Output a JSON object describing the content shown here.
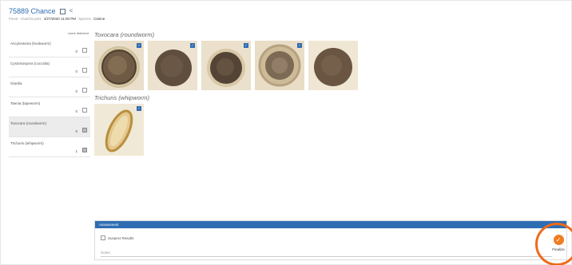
{
  "header": {
    "title": "75889 Chance",
    "sub_type": "Fecal - Ova/Oocysts",
    "sub_datetime": "4/27/2020 11:00 PM",
    "species_label": "Species",
    "species_value": "Canine"
  },
  "left_panel": {
    "column_header": "count detected",
    "items": [
      {
        "label": "Ancylostoma (hookworm)",
        "count": "0",
        "checked": false
      },
      {
        "label": "Cystoisospora (coccidia)",
        "count": "0",
        "checked": false
      },
      {
        "label": "Giardia",
        "count": "0",
        "checked": false
      },
      {
        "label": "Taenia (tapeworm)",
        "count": "0",
        "checked": false
      },
      {
        "label": "Toxocara (roundworm)",
        "count": "5",
        "checked": true
      },
      {
        "label": "Trichuris (whipworm)",
        "count": "1",
        "checked": true
      }
    ]
  },
  "sections": [
    {
      "title": "Toxocara (roundworm)",
      "image_count": 5
    },
    {
      "title": "Trichuris (whipworm)",
      "image_count": 1
    }
  ],
  "assessment": {
    "title": "Assessment",
    "suspect_label": "Suspect Results",
    "notes_placeholder": "Notes"
  },
  "finalize": {
    "label": "Finalize"
  },
  "colors": {
    "accent": "#2f6db3",
    "finalize": "#ef7d22",
    "highlight_ring": "#ef6a1a"
  }
}
